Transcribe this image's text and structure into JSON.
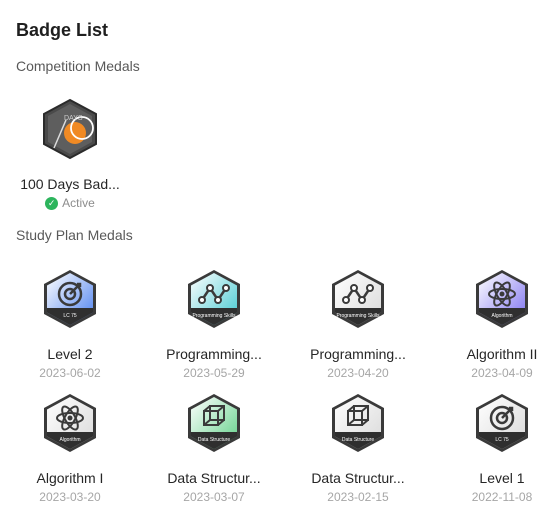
{
  "header": {
    "title": "Badge List"
  },
  "competition": {
    "title": "Competition Medals",
    "badges": [
      {
        "name": "100 Days Bad...",
        "status": "Active",
        "icon": "100-days-badge-icon",
        "tag": "DAYS"
      }
    ]
  },
  "study_plan": {
    "title": "Study Plan Medals",
    "badges": [
      {
        "name": "Level 2",
        "date": "2023-06-02",
        "icon": "lc75-target-icon",
        "tag": "LC 75",
        "color": "#4a7ff0"
      },
      {
        "name": "Programming...",
        "date": "2023-05-29",
        "icon": "programming-skills-icon",
        "tag": "Programming Skills",
        "color": "#3fc7cf"
      },
      {
        "name": "Programming...",
        "date": "2023-04-20",
        "icon": "programming-skills-icon",
        "tag": "Programming Skills",
        "color": "#d9d9d9"
      },
      {
        "name": "Algorithm II",
        "date": "2023-04-09",
        "icon": "algorithm-atom-icon",
        "tag": "Algorithm",
        "color": "#7b6ff0"
      },
      {
        "name": "Algorithm I",
        "date": "2023-03-20",
        "icon": "algorithm-atom-icon",
        "tag": "Algorithm",
        "color": "#d9d9d9"
      },
      {
        "name": "Data Structur...",
        "date": "2023-03-07",
        "icon": "data-structure-cube-icon",
        "tag": "Data Structure",
        "color": "#5fcf86"
      },
      {
        "name": "Data Structur...",
        "date": "2023-02-15",
        "icon": "data-structure-cube-icon",
        "tag": "Data Structure",
        "color": "#d9d9d9"
      },
      {
        "name": "Level 1",
        "date": "2022-11-08",
        "icon": "lc75-target-icon",
        "tag": "LC 75",
        "color": "#d9d9d9"
      }
    ]
  }
}
